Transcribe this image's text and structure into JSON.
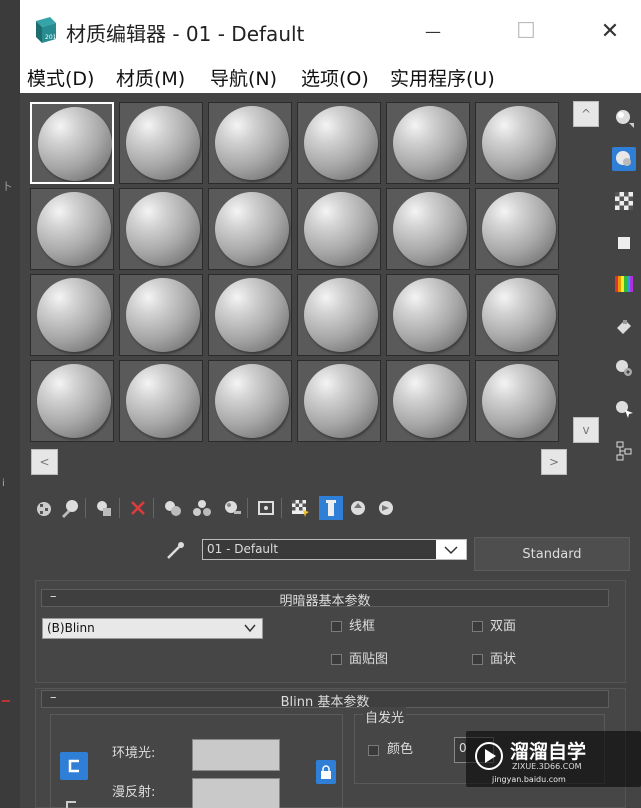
{
  "background": {
    "ticks": [
      "卜",
      "i"
    ]
  },
  "window": {
    "title": "材质编辑器 - 01 - Default",
    "app_icon": "3ds-max-icon",
    "controls": {
      "minimize": "—",
      "maximize": "☐",
      "close": "✕"
    }
  },
  "menu": [
    "模式(D)",
    "材质(M)",
    "导航(N)",
    "选项(O)",
    "实用程序(U)"
  ],
  "sample_slots": {
    "count": 24,
    "columns": 6,
    "rows": 4,
    "active_index": 0
  },
  "scroll": {
    "up": "^",
    "down": "v",
    "left": "<",
    "right": ">"
  },
  "side_tools": [
    "sample-type-sphere-icon",
    "backlight-icon",
    "background-checker-icon",
    "sample-uv-tiling-icon",
    "video-color-check-icon",
    "make-preview-icon",
    "options-icon",
    "select-by-material-icon",
    "material-map-navigator-icon"
  ],
  "toolbar_tools": [
    "get-material-icon",
    "put-to-scene-icon",
    "assign-to-selection-icon",
    "reset-map-icon",
    "make-copy-icon",
    "make-unique-icon",
    "put-to-library-icon",
    "material-id-channel-icon",
    "show-shaded-map-icon",
    "show-end-result-icon",
    "go-to-parent-icon",
    "go-forward-to-sibling-icon"
  ],
  "material": {
    "name": "01 - Default",
    "type": "Standard",
    "eyedropper": "eyedropper-icon"
  },
  "shader_basic": {
    "title": "明暗器基本参数",
    "shader": "(B)Blinn",
    "wire": "线框",
    "two_sided": "双面",
    "face_map": "面贴图",
    "faceted": "面状"
  },
  "blinn_basic": {
    "title": "Blinn 基本参数",
    "self_illum": "自发光",
    "color_label": "颜色",
    "color_value": "0",
    "ambient": "环境光:",
    "diffuse": "漫反射:"
  },
  "watermark": {
    "brand": "溜溜自学",
    "domain": "ZIXUE.3D66.COM",
    "url": "jingyan.baidu.com"
  },
  "colors": {
    "accent": "#2f7fd6",
    "panel": "#444444",
    "titlebar": "#ffffff"
  }
}
